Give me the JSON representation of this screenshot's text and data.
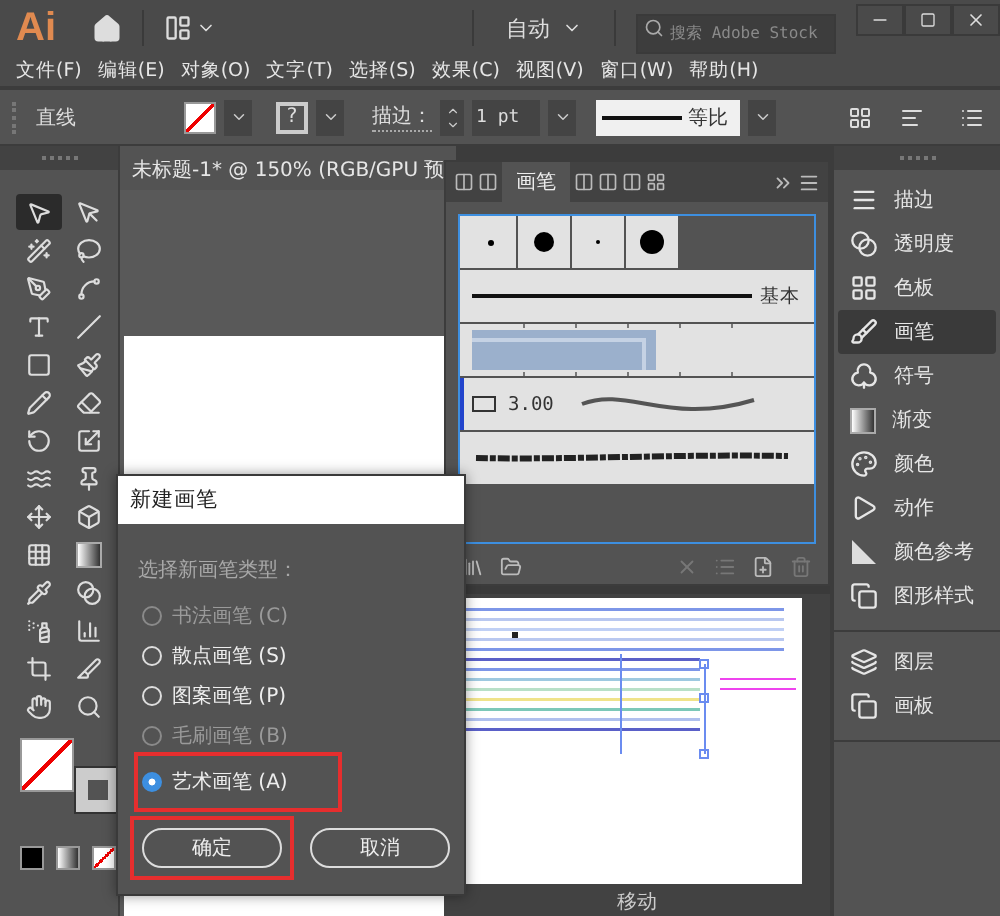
{
  "app": {
    "logo": "Ai",
    "workspace": "自动",
    "search": {
      "placeholder": "搜索 Adobe Stock"
    }
  },
  "menu": [
    "文件(F)",
    "编辑(E)",
    "对象(O)",
    "文字(T)",
    "选择(S)",
    "效果(C)",
    "视图(V)",
    "窗口(W)",
    "帮助(H)"
  ],
  "control_bar": {
    "selection": "直线",
    "stroke_swatch": "?",
    "stroke_label": "描边：",
    "stroke_weight": "1 pt",
    "profile": "等比"
  },
  "document": {
    "tab": "未标题-1* @ 150% (RGB/GPU 预"
  },
  "tools": [
    {
      "selected": true
    },
    {
      "selected": false
    },
    {
      "selected": false
    },
    {
      "selected": false
    },
    {
      "selected": false
    },
    {
      "selected": false
    },
    {
      "selected": false
    },
    {
      "selected": false
    },
    {
      "selected": false
    },
    {
      "selected": false
    },
    {
      "selected": false
    },
    {
      "selected": false
    },
    {
      "selected": false
    },
    {
      "selected": false
    },
    {
      "selected": false
    },
    {
      "selected": false
    },
    {
      "selected": false
    },
    {
      "selected": false
    },
    {
      "selected": false
    },
    {
      "selected": false
    },
    {
      "selected": false
    },
    {
      "selected": false
    },
    {
      "selected": false
    },
    {
      "selected": false
    },
    {
      "selected": false
    },
    {
      "selected": false
    },
    {
      "selected": false
    },
    {
      "selected": false
    }
  ],
  "brush_panel": {
    "tab": {
      "label": "画笔",
      "selected": true
    },
    "brushes": [
      {
        "kind": "dots",
        "selected": false
      },
      {
        "kind": "line",
        "label": "基本",
        "selected": false
      },
      {
        "kind": "pattern",
        "selected": false
      },
      {
        "kind": "calligraphic",
        "label": "3.00",
        "selected": true
      },
      {
        "kind": "charcoal",
        "selected": false
      }
    ]
  },
  "artwork_panel": {
    "footer": "移动"
  },
  "dock": {
    "groups": [
      [
        {
          "label": "描边",
          "selected": false
        },
        {
          "label": "透明度",
          "selected": false
        },
        {
          "label": "色板",
          "selected": false
        },
        {
          "label": "画笔",
          "selected": true
        },
        {
          "label": "符号",
          "selected": false
        },
        {
          "label": "渐变",
          "selected": false
        },
        {
          "label": "颜色",
          "selected": false
        },
        {
          "label": "动作",
          "selected": false
        },
        {
          "label": "颜色参考",
          "selected": false
        },
        {
          "label": "图形样式",
          "selected": false
        }
      ],
      [
        {
          "label": "图层",
          "selected": false
        },
        {
          "label": "画板",
          "selected": false
        }
      ]
    ]
  },
  "dialog": {
    "title": "新建画笔",
    "prompt": "选择新画笔类型：",
    "options": [
      {
        "label": "书法画笔 (C)",
        "disabled": true,
        "selected": false,
        "annotated": false
      },
      {
        "label": "散点画笔 (S)",
        "disabled": false,
        "selected": false,
        "annotated": false
      },
      {
        "label": "图案画笔 (P)",
        "disabled": false,
        "selected": false,
        "annotated": false
      },
      {
        "label": "毛刷画笔 (B)",
        "disabled": true,
        "selected": false,
        "annotated": false
      },
      {
        "label": "艺术画笔 (A)",
        "disabled": false,
        "selected": true,
        "annotated": true
      }
    ],
    "buttons": [
      {
        "label": "确定",
        "annotated": true
      },
      {
        "label": "取消",
        "annotated": false
      }
    ]
  }
}
